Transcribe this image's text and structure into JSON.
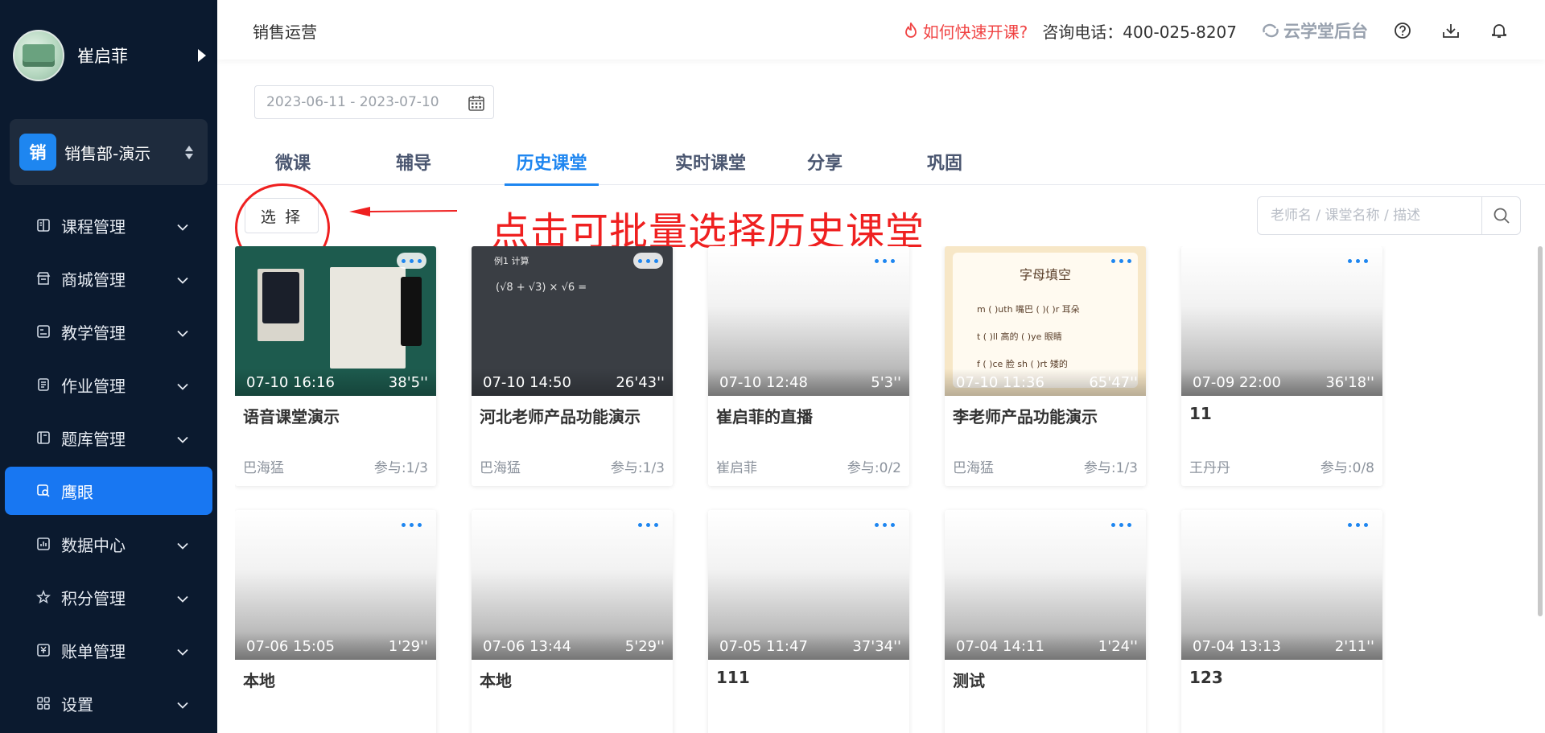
{
  "sidebar": {
    "user_name": "崔启菲",
    "dept_badge": "销",
    "dept_name": "销售部-演示",
    "items": [
      {
        "label": "课程管理",
        "icon": "book-icon",
        "active": false
      },
      {
        "label": "商城管理",
        "icon": "store-icon",
        "active": false
      },
      {
        "label": "教学管理",
        "icon": "teaching-icon",
        "active": false
      },
      {
        "label": "作业管理",
        "icon": "homework-icon",
        "active": false
      },
      {
        "label": "题库管理",
        "icon": "question-bank-icon",
        "active": false
      },
      {
        "label": "鹰眼",
        "icon": "eagle-eye-icon",
        "active": true
      },
      {
        "label": "数据中心",
        "icon": "bar-chart-icon",
        "active": false
      },
      {
        "label": "积分管理",
        "icon": "star-icon",
        "active": false
      },
      {
        "label": "账单管理",
        "icon": "bill-icon",
        "active": false
      },
      {
        "label": "设置",
        "icon": "settings-grid-icon",
        "active": false
      }
    ]
  },
  "header": {
    "title": "销售运营",
    "quick_start": "如何快速开课?",
    "phone": "咨询电话：400-025-8207",
    "brand": "云学堂后台"
  },
  "filters": {
    "date_range": "2023-06-11 - 2023-07-10"
  },
  "tabs": [
    {
      "label": "微课",
      "active": false
    },
    {
      "label": "辅导",
      "active": false
    },
    {
      "label": "历史课堂",
      "active": true
    },
    {
      "label": "实时课堂",
      "active": false
    },
    {
      "label": "分享",
      "active": false
    },
    {
      "label": "巩固",
      "active": false
    }
  ],
  "toolbar": {
    "select_label": "选 择",
    "search_placeholder": "老师名 / 课堂名称 / 描述"
  },
  "annotation": {
    "text": "点击可批量选择历史课堂"
  },
  "thumb_text": {
    "math_title": "例1  计算",
    "math_expr": "(√8 + √3) × √6  =",
    "poster_title": "字母填空",
    "poster_lines": [
      "m (  )uth 嘴巴    (  )(  )r 耳朵",
      "t (  )ll 高的        (  )ye 眼睛",
      "f (  )ce 脸          sh (  )rt 矮的"
    ]
  },
  "cards": [
    {
      "time": "07-10 16:16",
      "duration": "38'5''",
      "title": "语音课堂演示",
      "teacher": "巴海猛",
      "participation": "参与:1/3",
      "thumb": "green"
    },
    {
      "time": "07-10 14:50",
      "duration": "26'43''",
      "title": "河北老师产品功能演示",
      "teacher": "巴海猛",
      "participation": "参与:1/3",
      "thumb": "dark"
    },
    {
      "time": "07-10 12:48",
      "duration": "5'3''",
      "title": "崔启菲的直播",
      "teacher": "崔启菲",
      "participation": "参与:0/2",
      "thumb": "blank"
    },
    {
      "time": "07-10 11:36",
      "duration": "65'47''",
      "title": "李老师产品功能演示",
      "teacher": "巴海猛",
      "participation": "参与:1/3",
      "thumb": "poster"
    },
    {
      "time": "07-09 22:00",
      "duration": "36'18''",
      "title": "11",
      "teacher": "王丹丹",
      "participation": "参与:0/8",
      "thumb": "blank"
    },
    {
      "time": "07-06 15:05",
      "duration": "1'29''",
      "title": "本地",
      "teacher": "",
      "participation": "",
      "thumb": "blank"
    },
    {
      "time": "07-06 13:44",
      "duration": "5'29''",
      "title": "本地",
      "teacher": "",
      "participation": "",
      "thumb": "blank"
    },
    {
      "time": "07-05 11:47",
      "duration": "37'34''",
      "title": "111",
      "teacher": "",
      "participation": "",
      "thumb": "blank"
    },
    {
      "time": "07-04 14:11",
      "duration": "1'24''",
      "title": "测试",
      "teacher": "",
      "participation": "",
      "thumb": "blank"
    },
    {
      "time": "07-04 13:13",
      "duration": "2'11''",
      "title": "123",
      "teacher": "",
      "participation": "",
      "thumb": "blank"
    }
  ],
  "colors": {
    "sidebar_bg": "#0b1a2f",
    "accent": "#1e86f0",
    "annotation_red": "#ef2020",
    "quick_start_red": "#f04444"
  }
}
